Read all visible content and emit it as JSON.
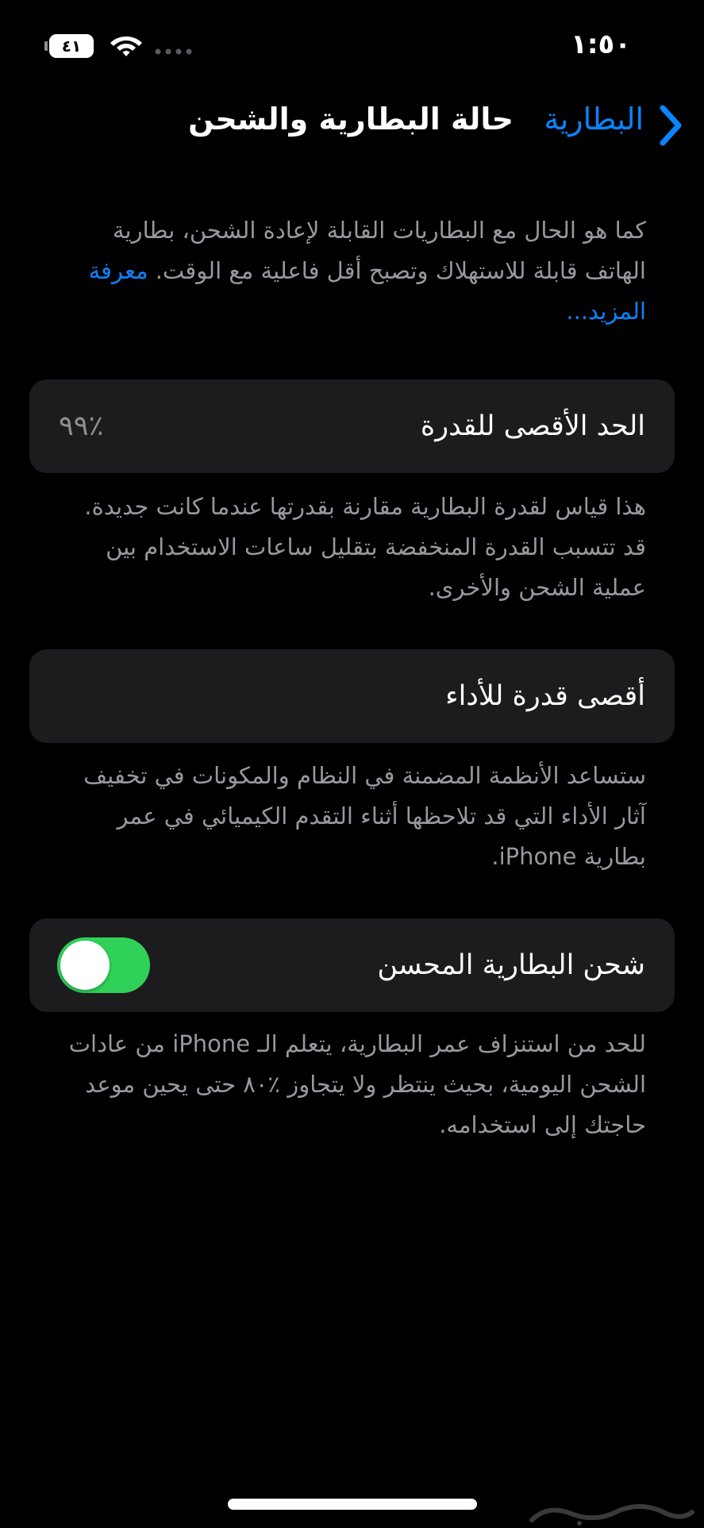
{
  "status_bar": {
    "time": "١:٥٠",
    "battery_level": "٤١",
    "icons": [
      "battery-icon",
      "wifi-icon",
      "cellular-signal-icon"
    ]
  },
  "nav": {
    "back_label": "البطارية",
    "title": "حالة البطارية والشحن",
    "back_icon": "chevron-right-icon"
  },
  "intro": {
    "text": "كما هو الحال مع البطاريات القابلة لإعادة الشحن، بطارية الهاتف قابلة للاستهلاك وتصبح أقل فاعلية مع الوقت.",
    "learn_more": "معرفة المزيد..."
  },
  "maximum_capacity": {
    "title": "الحد الأقصى للقدرة",
    "value": "٪٩٩",
    "footer": "هذا قياس لقدرة البطارية مقارنة بقدرتها عندما كانت جديدة. قد تتسبب القدرة المنخفضة بتقليل ساعات الاستخدام بين عملية الشحن والأخرى."
  },
  "peak_performance": {
    "title": "أقصى قدرة للأداء",
    "footer": "ستساعد الأنظمة المضمنة في النظام والمكونات في تخفيف آثار الأداء التي قد تلاحظها أثناء التقدم الكيميائي في عمر بطارية iPhone."
  },
  "optimized_charging": {
    "title": "شحن البطارية المحسن",
    "enabled": true,
    "footer": "للحد من استنزاف عمر البطارية، يتعلم الـ iPhone من عادات الشحن اليومية، بحيث ينتظر ولا يتجاوز ٪٨٠ حتى يحين موعد حاجتك إلى استخدامه."
  },
  "watermark": {
    "logo": "حراج"
  },
  "colors": {
    "background": "#000000",
    "group_background": "#1c1c1e",
    "accent": "#0a84ff",
    "toggle_on": "#30d158",
    "secondary_text": "#98989f"
  }
}
